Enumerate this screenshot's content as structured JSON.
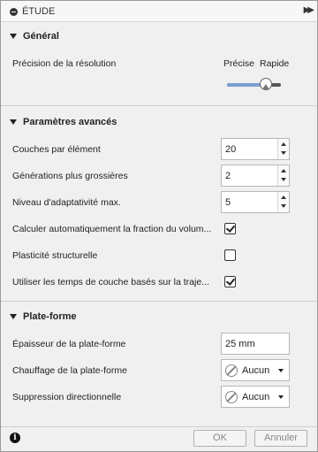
{
  "window": {
    "title": "ÉTUDE"
  },
  "general": {
    "header": "Général",
    "resolution_label": "Précision de la résolution",
    "slider_left_label": "Précise",
    "slider_right_label": "Rapide",
    "slider_value_percent": 72
  },
  "advanced": {
    "header": "Paramètres avancés",
    "layers_label": "Couches par élément",
    "layers_value": "20",
    "coarse_label": "Générations plus grossières",
    "coarse_value": "2",
    "adapt_label": "Niveau d'adaptativité max.",
    "adapt_value": "5",
    "auto_volume_label": "Calculer automatiquement la fraction du volum...",
    "auto_volume_checked": true,
    "plasticity_label": "Plasticité structurelle",
    "plasticity_checked": false,
    "layer_times_label": "Utiliser les temps de couche basés sur la traje...",
    "layer_times_checked": true
  },
  "platform": {
    "header": "Plate-forme",
    "thickness_label": "Épaisseur de la plate-forme",
    "thickness_value": "25 mm",
    "heating_label": "Chauffage de la plate-forme",
    "heating_value": "Aucun",
    "suppression_label": "Suppression directionnelle",
    "suppression_value": "Aucun"
  },
  "footer": {
    "ok_label": "OK",
    "cancel_label": "Annuler"
  },
  "colors": {
    "slider_fill": "#7b9fd0"
  }
}
